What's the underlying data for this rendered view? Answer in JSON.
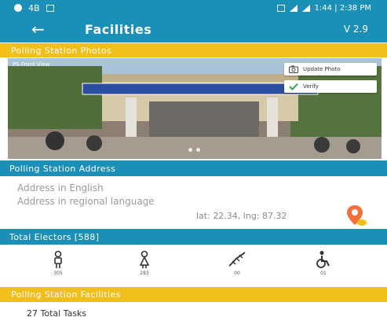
{
  "status_bar": {
    "left_items": [
      "9",
      "4B"
    ],
    "right_text": "1:44 | 2:38 PM"
  },
  "appbar": {
    "back_glyph": "←",
    "title": "Facilities",
    "version": "V 2.9"
  },
  "sections": {
    "photos": "Polling Station Photos",
    "address": "Polling Station Address",
    "electors": "Total Electors [588]",
    "facilities": "Polling Station Facilities"
  },
  "photo": {
    "label": "PS Front View",
    "update_button": "Update Photo",
    "verify_button": "Verify"
  },
  "address": {
    "english_placeholder": "Address in English",
    "regional_placeholder": "Address in regional language",
    "latlng": "lat: 22.34, lng: 87.32"
  },
  "electors": [
    {
      "icon": "male-voter-icon",
      "count": "305"
    },
    {
      "icon": "female-voter-icon",
      "count": "283"
    },
    {
      "icon": "third-gender-icon",
      "count": "00"
    },
    {
      "icon": "disabled-voter-icon",
      "count": "01"
    }
  ],
  "tasks": {
    "label": "27 Total Tasks"
  },
  "colors": {
    "primary": "#1a8fb8",
    "accent": "#f2be1a",
    "pin": "#f56f3c",
    "verify_check": "#2aa84a"
  }
}
